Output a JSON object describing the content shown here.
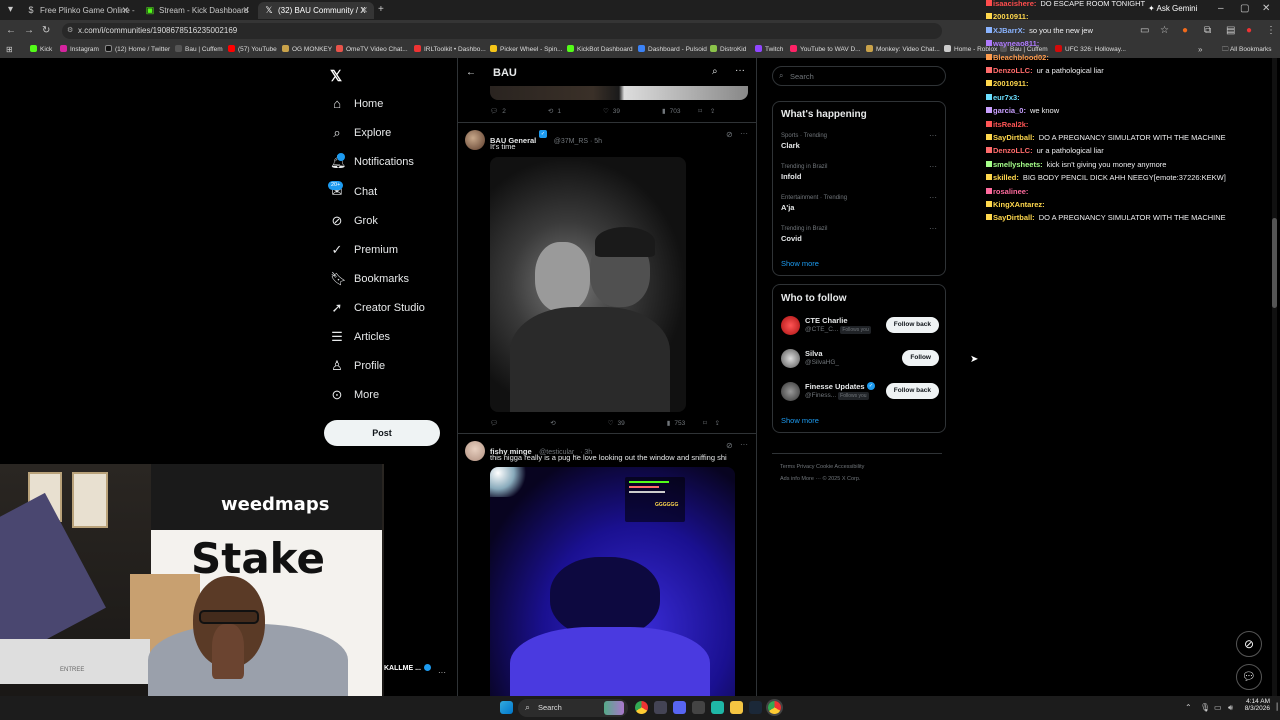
{
  "browser": {
    "tabs": [
      {
        "label": "Free Plinko Game Online - Play",
        "active": false
      },
      {
        "label": "Stream - Kick Dashboard",
        "active": false
      },
      {
        "label": "(32) BAU Community / X",
        "active": true
      }
    ],
    "new_tab": "+",
    "url": "x.com/i/communities/1908678516235002169",
    "bookmarks": [
      "Kick",
      "Instagram",
      "(12) Home / Twitter",
      "Bau | Cuffem",
      "(57) YouTube",
      "OG MONKEY",
      "OmeTV Video Chat...",
      "IRLToolkit • Dashbo...",
      "Picker Wheel - Spin...",
      "KickBot Dashboard",
      "Dashboard - Pulsoid",
      "DistroKid",
      "Twitch",
      "YouTube to WAV D...",
      "Monkey: Video Chat...",
      "Home - Roblox",
      "Bau | Cuffem",
      "UFC 326: Holloway..."
    ],
    "all_bookmarks": "All Bookmarks",
    "ask_gemini": "Ask Gemini"
  },
  "nav": {
    "items": [
      {
        "label": "Home",
        "icon": "home-icon"
      },
      {
        "label": "Explore",
        "icon": "search-icon"
      },
      {
        "label": "Notifications",
        "icon": "bell-icon"
      },
      {
        "label": "Chat",
        "icon": "chat-icon"
      },
      {
        "label": "Grok",
        "icon": "grok-icon"
      },
      {
        "label": "Premium",
        "icon": "premium-icon"
      },
      {
        "label": "Bookmarks",
        "icon": "bookmark-icon"
      },
      {
        "label": "Creator Studio",
        "icon": "rocket-icon"
      },
      {
        "label": "Articles",
        "icon": "article-icon"
      },
      {
        "label": "Profile",
        "icon": "person-icon"
      },
      {
        "label": "More",
        "icon": "more-icon"
      }
    ],
    "chat_badge": "20+",
    "post_button": "Post"
  },
  "community": {
    "title": "BAU"
  },
  "tweets": [
    {
      "replies": "2",
      "retweets": "1",
      "likes": "39",
      "views": "703"
    },
    {
      "name": "BAU General",
      "handle": "@37M_RS · 5h",
      "text": "It's time",
      "replies": "",
      "retweets": "",
      "likes": "39",
      "views": "753"
    },
    {
      "name": "fishy minge",
      "handle": "@testicular_ · 3h",
      "text": "this nigga really is a pug he love looking out the window and sniffing shi",
      "embedded_text": "GGGGGG"
    }
  ],
  "sidebar": {
    "search_placeholder": "Search",
    "trending_title": "What's happening",
    "trends": [
      {
        "context": "Sports · Trending",
        "topic": "Clark"
      },
      {
        "context": "Trending in Brazil",
        "topic": "Infold"
      },
      {
        "context": "Entertainment · Trending",
        "topic": "A'ja"
      },
      {
        "context": "Trending in Brazil",
        "topic": "Covid"
      }
    ],
    "show_more": "Show more",
    "follow_title": "Who to follow",
    "follow": [
      {
        "name": "CTE Charlie",
        "handle": "@CTE_C...",
        "follows_you": "Follows you",
        "button": "Follow back"
      },
      {
        "name": "Silva",
        "handle": "@SilvaHG_",
        "follows_you": "",
        "button": "Follow"
      },
      {
        "name": "Finesse Updates",
        "handle": "@Finess...",
        "follows_you": "Follows you",
        "button": "Follow back"
      }
    ],
    "footer_line1": "Terms   Privacy   Cookie   Accessibility",
    "footer_line2": "Ads info   More ···   © 2025 X Corp."
  },
  "chat": {
    "messages": [
      {
        "user": "isaacishere:",
        "text": "DO ESCAPE ROOM TONIGHT",
        "color": "#ff4d4d"
      },
      {
        "user": "20010911:",
        "text": "",
        "color": "#ffd84d"
      },
      {
        "user": "XJBarrX:",
        "text": "so you the new jew",
        "color": "#8ab4ff"
      },
      {
        "user": "wayneao811:",
        "text": "",
        "color": "#b07bff"
      },
      {
        "user": "Bleachblood02:",
        "text": "",
        "color": "#ff9c4d"
      },
      {
        "user": "DenzoLLC:",
        "text": "ur a pathological liar",
        "color": "#ff6b6b"
      },
      {
        "user": "20010911:",
        "text": "",
        "color": "#ffd84d"
      },
      {
        "user": "eur7x3:",
        "text": "",
        "color": "#6bdfff"
      },
      {
        "user": "garcia_0:",
        "text": "we know",
        "color": "#c9a0ff"
      },
      {
        "user": "itsReal2k:",
        "text": "",
        "color": "#ff5555"
      },
      {
        "user": "SayDirtball:",
        "text": "DO A PREGNANCY SIMULATOR WITH THE MACHINE",
        "color": "#ffd84d"
      },
      {
        "user": "DenzoLLC:",
        "text": "ur a pathological liar",
        "color": "#ff6b6b"
      },
      {
        "user": "smellysheets:",
        "text": "kick isn't giving you money anymore",
        "color": "#a6ff8a"
      },
      {
        "user": "skilled:",
        "text": "BIG BODY PENCIL DICK AHH NEEGY[emote:37226:KEKW]",
        "color": "#ffd84d"
      },
      {
        "user": "rosalinee:",
        "text": "",
        "color": "#ff6b9e"
      },
      {
        "user": "KingXAntarez:",
        "text": "",
        "color": "#ffd84d"
      },
      {
        "user": "SayDirtball:",
        "text": "DO A PREGNANCY SIMULATOR WITH THE MACHINE",
        "color": "#ffd84d"
      }
    ]
  },
  "webcam": {
    "banner_brand": "weedmaps",
    "banner_sponsor": "Stake",
    "mattress_label": "ENTREE",
    "overlay_name": "KALLME ...",
    "overlay_more": "···"
  },
  "taskbar": {
    "search": "Search",
    "time": "4:14 AM",
    "date": "8/3/2026"
  },
  "colors": {
    "accent": "#1d9bf0",
    "verified": "#1d9bf0",
    "background": "#000000",
    "chrome": "#353535"
  }
}
